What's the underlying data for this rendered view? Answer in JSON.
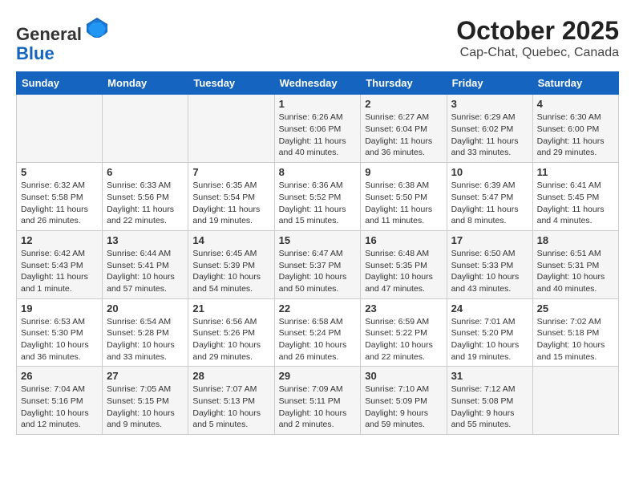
{
  "header": {
    "logo_line1": "General",
    "logo_line2": "Blue",
    "month": "October 2025",
    "location": "Cap-Chat, Quebec, Canada"
  },
  "weekdays": [
    "Sunday",
    "Monday",
    "Tuesday",
    "Wednesday",
    "Thursday",
    "Friday",
    "Saturday"
  ],
  "weeks": [
    [
      {
        "day": "",
        "info": ""
      },
      {
        "day": "",
        "info": ""
      },
      {
        "day": "",
        "info": ""
      },
      {
        "day": "1",
        "info": "Sunrise: 6:26 AM\nSunset: 6:06 PM\nDaylight: 11 hours and 40 minutes."
      },
      {
        "day": "2",
        "info": "Sunrise: 6:27 AM\nSunset: 6:04 PM\nDaylight: 11 hours and 36 minutes."
      },
      {
        "day": "3",
        "info": "Sunrise: 6:29 AM\nSunset: 6:02 PM\nDaylight: 11 hours and 33 minutes."
      },
      {
        "day": "4",
        "info": "Sunrise: 6:30 AM\nSunset: 6:00 PM\nDaylight: 11 hours and 29 minutes."
      }
    ],
    [
      {
        "day": "5",
        "info": "Sunrise: 6:32 AM\nSunset: 5:58 PM\nDaylight: 11 hours and 26 minutes."
      },
      {
        "day": "6",
        "info": "Sunrise: 6:33 AM\nSunset: 5:56 PM\nDaylight: 11 hours and 22 minutes."
      },
      {
        "day": "7",
        "info": "Sunrise: 6:35 AM\nSunset: 5:54 PM\nDaylight: 11 hours and 19 minutes."
      },
      {
        "day": "8",
        "info": "Sunrise: 6:36 AM\nSunset: 5:52 PM\nDaylight: 11 hours and 15 minutes."
      },
      {
        "day": "9",
        "info": "Sunrise: 6:38 AM\nSunset: 5:50 PM\nDaylight: 11 hours and 11 minutes."
      },
      {
        "day": "10",
        "info": "Sunrise: 6:39 AM\nSunset: 5:47 PM\nDaylight: 11 hours and 8 minutes."
      },
      {
        "day": "11",
        "info": "Sunrise: 6:41 AM\nSunset: 5:45 PM\nDaylight: 11 hours and 4 minutes."
      }
    ],
    [
      {
        "day": "12",
        "info": "Sunrise: 6:42 AM\nSunset: 5:43 PM\nDaylight: 11 hours and 1 minute."
      },
      {
        "day": "13",
        "info": "Sunrise: 6:44 AM\nSunset: 5:41 PM\nDaylight: 10 hours and 57 minutes."
      },
      {
        "day": "14",
        "info": "Sunrise: 6:45 AM\nSunset: 5:39 PM\nDaylight: 10 hours and 54 minutes."
      },
      {
        "day": "15",
        "info": "Sunrise: 6:47 AM\nSunset: 5:37 PM\nDaylight: 10 hours and 50 minutes."
      },
      {
        "day": "16",
        "info": "Sunrise: 6:48 AM\nSunset: 5:35 PM\nDaylight: 10 hours and 47 minutes."
      },
      {
        "day": "17",
        "info": "Sunrise: 6:50 AM\nSunset: 5:33 PM\nDaylight: 10 hours and 43 minutes."
      },
      {
        "day": "18",
        "info": "Sunrise: 6:51 AM\nSunset: 5:31 PM\nDaylight: 10 hours and 40 minutes."
      }
    ],
    [
      {
        "day": "19",
        "info": "Sunrise: 6:53 AM\nSunset: 5:30 PM\nDaylight: 10 hours and 36 minutes."
      },
      {
        "day": "20",
        "info": "Sunrise: 6:54 AM\nSunset: 5:28 PM\nDaylight: 10 hours and 33 minutes."
      },
      {
        "day": "21",
        "info": "Sunrise: 6:56 AM\nSunset: 5:26 PM\nDaylight: 10 hours and 29 minutes."
      },
      {
        "day": "22",
        "info": "Sunrise: 6:58 AM\nSunset: 5:24 PM\nDaylight: 10 hours and 26 minutes."
      },
      {
        "day": "23",
        "info": "Sunrise: 6:59 AM\nSunset: 5:22 PM\nDaylight: 10 hours and 22 minutes."
      },
      {
        "day": "24",
        "info": "Sunrise: 7:01 AM\nSunset: 5:20 PM\nDaylight: 10 hours and 19 minutes."
      },
      {
        "day": "25",
        "info": "Sunrise: 7:02 AM\nSunset: 5:18 PM\nDaylight: 10 hours and 15 minutes."
      }
    ],
    [
      {
        "day": "26",
        "info": "Sunrise: 7:04 AM\nSunset: 5:16 PM\nDaylight: 10 hours and 12 minutes."
      },
      {
        "day": "27",
        "info": "Sunrise: 7:05 AM\nSunset: 5:15 PM\nDaylight: 10 hours and 9 minutes."
      },
      {
        "day": "28",
        "info": "Sunrise: 7:07 AM\nSunset: 5:13 PM\nDaylight: 10 hours and 5 minutes."
      },
      {
        "day": "29",
        "info": "Sunrise: 7:09 AM\nSunset: 5:11 PM\nDaylight: 10 hours and 2 minutes."
      },
      {
        "day": "30",
        "info": "Sunrise: 7:10 AM\nSunset: 5:09 PM\nDaylight: 9 hours and 59 minutes."
      },
      {
        "day": "31",
        "info": "Sunrise: 7:12 AM\nSunset: 5:08 PM\nDaylight: 9 hours and 55 minutes."
      },
      {
        "day": "",
        "info": ""
      }
    ]
  ]
}
